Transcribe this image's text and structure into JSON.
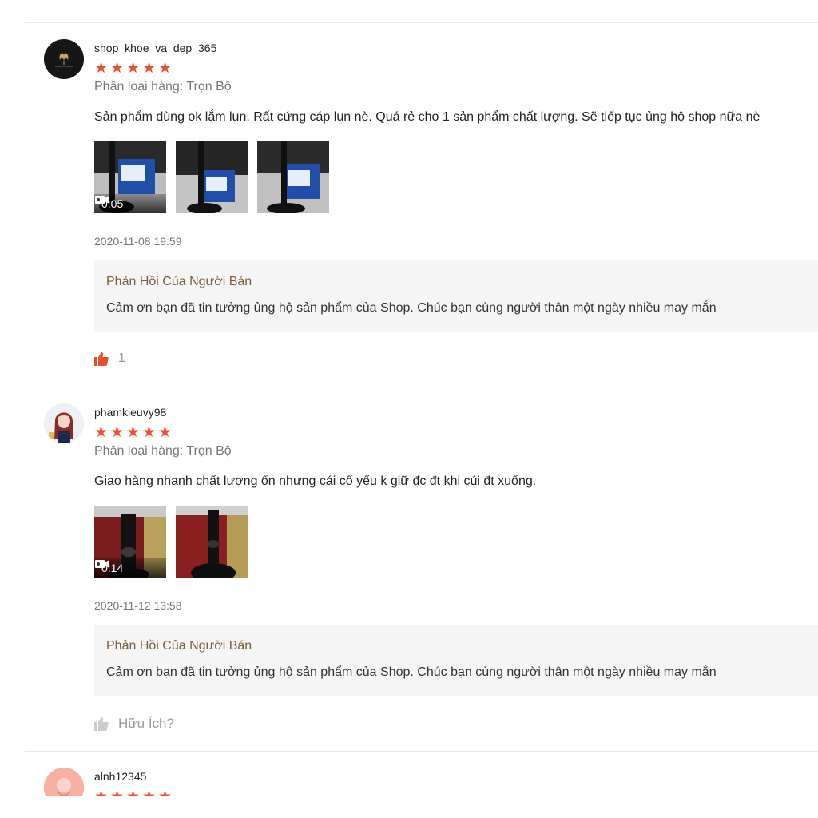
{
  "reviews": [
    {
      "username": "shop_khoe_va_dep_365",
      "avatar_text": "Clemy Beauty",
      "rating": 5,
      "variant": "Phân loại hàng: Trọn Bộ",
      "comment": "Sản phẩm dùng ok lắm lun. Rất cứng cáp lun nè. Quá rẻ cho 1 sản phẩm chất lượng. Sẽ tiếp tục ủng hộ shop nữa nè",
      "video_duration": "0:05",
      "timestamp": "2020-11-08 19:59",
      "reply_title": "Phản Hồi Của Người Bán",
      "reply_text": "Cảm ơn bạn đã tin tưởng ủng hộ sản phẩm của Shop. Chúc bạn cùng người thân một ngày nhiều may mắn",
      "like_count": "1"
    },
    {
      "username": "phamkieuvy98",
      "rating": 5,
      "variant": "Phân loại hàng: Trọn Bộ",
      "comment": "Giao hàng nhanh chất lượng ổn nhưng cái cổ yếu k giữ đc đt khi cúi đt xuống.",
      "video_duration": "0:14",
      "timestamp": "2020-11-12 13:58",
      "reply_title": "Phản Hồi Của Người Bán",
      "reply_text": "Cảm ơn bạn đã tin tưởng ủng hộ sản phẩm của Shop. Chúc bạn cùng người thân một ngày nhiều may mắn",
      "helpful_label": "Hữu Ích?"
    },
    {
      "username": "alnh12345",
      "rating": 5
    }
  ],
  "colors": {
    "star": "#ee4d2d",
    "like_active": "#ee4d2d",
    "like_inactive": "#cccccc",
    "reply_bg": "#f5f5f5",
    "reply_title": "#7b5e3b"
  },
  "icons": {
    "star": "★",
    "like": "thumbs-up-icon",
    "video": "video-camera-icon"
  }
}
